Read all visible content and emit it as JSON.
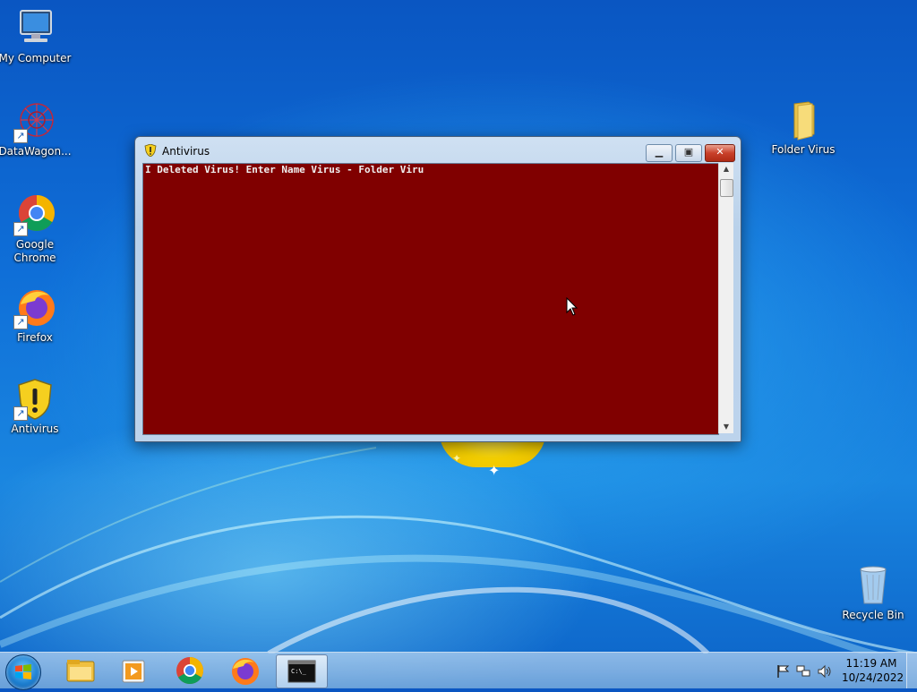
{
  "desktop": {
    "icons": [
      {
        "label": "My Computer",
        "icon": "computer-icon"
      },
      {
        "label": "DataWagon...",
        "icon": "datawagon-icon"
      },
      {
        "label": "Google Chrome",
        "icon": "chrome-icon"
      },
      {
        "label": "Firefox",
        "icon": "firefox-icon"
      },
      {
        "label": "Antivirus",
        "icon": "antivirus-shield-icon"
      },
      {
        "label": "Folder Virus",
        "icon": "folder-icon"
      },
      {
        "label": "Recycle Bin",
        "icon": "recycle-bin-icon"
      }
    ]
  },
  "window": {
    "title": "Antivirus",
    "console_text": "I Deleted Virus! Enter Name Virus - Folder Viru",
    "console_bg": "#800000",
    "buttons": {
      "minimize": "minimize-icon",
      "maximize": "maximize-icon",
      "close": "close-icon"
    }
  },
  "taskbar": {
    "start": "windows-start-icon",
    "pinned": [
      "file-explorer-icon",
      "media-player-icon",
      "chrome-icon",
      "firefox-icon",
      "cmd-icon"
    ],
    "tray": [
      "action-center-flag-icon",
      "network-icon",
      "volume-icon"
    ],
    "clock": {
      "time": "11:19 AM",
      "date": "10/24/2022"
    }
  }
}
